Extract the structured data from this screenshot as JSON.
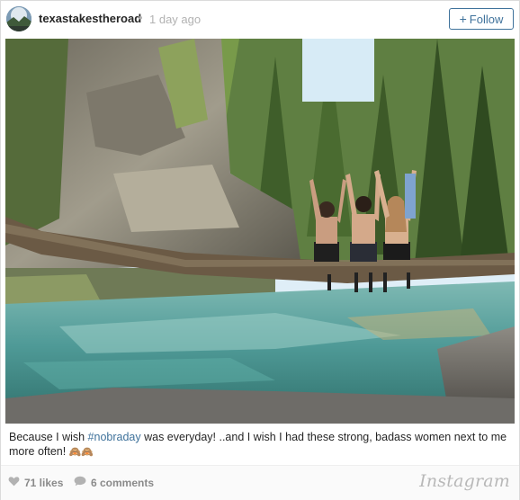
{
  "post": {
    "username": "texastakestheroad",
    "separator": "•",
    "time_ago": "1 day ago",
    "follow_plus": "+",
    "follow_label": "Follow"
  },
  "caption": {
    "text_before": "Because I wish ",
    "hashtag": "#nobraday",
    "text_after": " was everyday! ..and I wish I had these strong, badass women next to me more often! ",
    "emoji": "🙈🙈"
  },
  "footer": {
    "likes": "71 likes",
    "comments": "6 comments",
    "brand": "Instagram"
  },
  "colors": {
    "link": "#3f729b",
    "muted": "#b2b2b2",
    "text": "#262626"
  },
  "icons": [
    "heart-icon",
    "comment-bubble-icon",
    "plus-icon"
  ]
}
